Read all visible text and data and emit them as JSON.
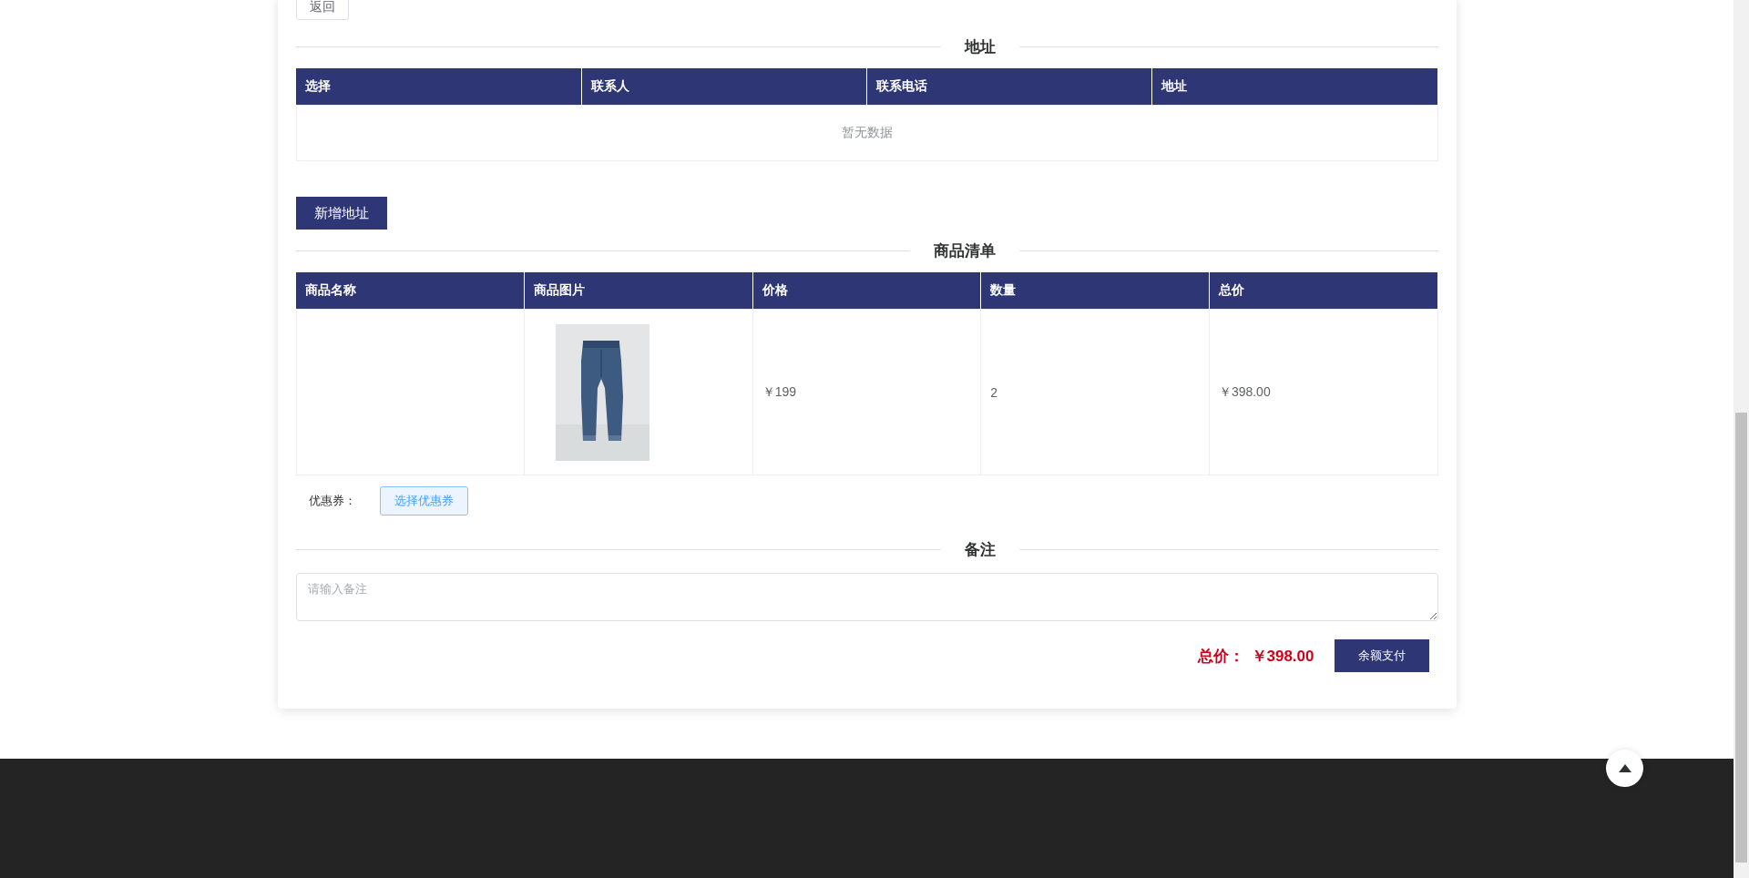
{
  "back_button": "返回",
  "address_section": {
    "title": "地址",
    "table": {
      "columns": [
        "选择",
        "联系人",
        "联系电话",
        "地址"
      ],
      "empty_text": "暂无数据"
    }
  },
  "add_address_button": "新增地址",
  "goods_section": {
    "title": "商品清单",
    "table": {
      "columns": [
        "商品名称",
        "商品图片",
        "价格",
        "数量",
        "总价"
      ],
      "rows": [
        {
          "price": "￥199",
          "quantity": "2",
          "total": "￥398.00"
        }
      ]
    }
  },
  "coupon": {
    "label": "优惠券：",
    "button": "选择优惠券"
  },
  "remark_section": {
    "title": "备注",
    "placeholder": "请输入备注"
  },
  "total": {
    "label": "总价：",
    "value": "￥398.00"
  },
  "pay_button": "余额支付"
}
